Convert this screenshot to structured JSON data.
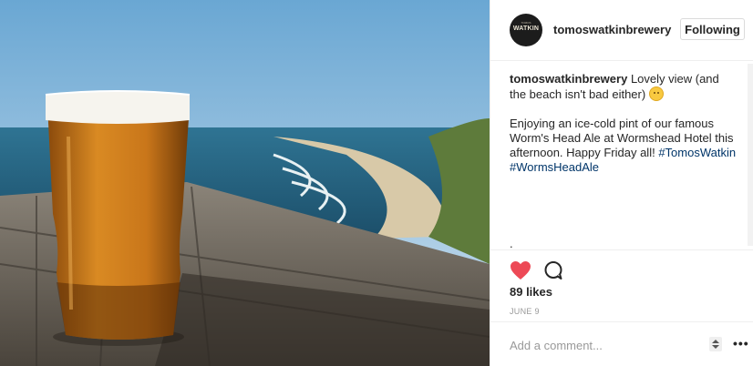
{
  "post": {
    "username": "tomoswatkinbrewery",
    "follow_label": "Following",
    "avatar_text": "WATKIN",
    "avatar_small_text": "TOMOS",
    "caption": {
      "user": "tomoswatkinbrewery",
      "line1": " Lovely view (and the beach isn't bad either) ",
      "para2_text": "Enjoying an ice-cold pint of our famous Worm's Head Ale at Wormshead Hotel this afternoon. Happy Friday all! ",
      "hashtag1": "#TomosWatkin",
      "hashtag2": "#WormsHeadAle",
      "trailing": "."
    },
    "likes": "89 likes",
    "date": "JUNE 9",
    "comment_placeholder": "Add a comment...",
    "more_label": "•••"
  },
  "colors": {
    "heart": "#ed4956",
    "hashtag": "#003569",
    "muted": "#999999",
    "border": "#efefef"
  },
  "icons": [
    "heart-icon",
    "comment-icon",
    "more-icon",
    "stepper-icon"
  ]
}
